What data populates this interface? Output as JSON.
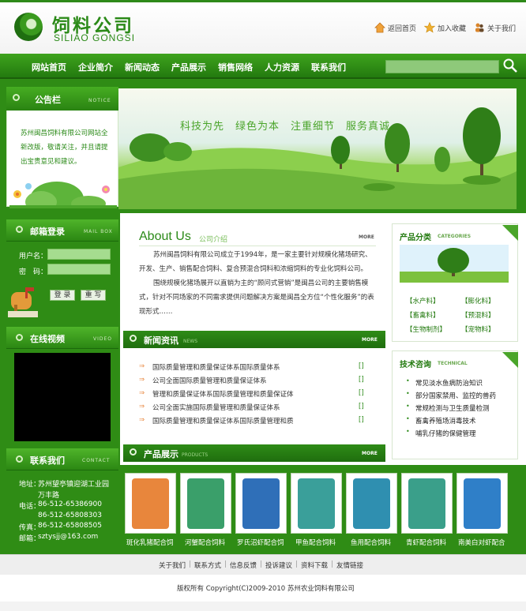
{
  "header": {
    "logo_cn": "饲料公司",
    "logo_en": "SILIAO GONGSI",
    "links": [
      {
        "label": "返回首页",
        "icon": "home-icon"
      },
      {
        "label": "加入收藏",
        "icon": "star-icon"
      },
      {
        "label": "关于我们",
        "icon": "people-icon"
      }
    ]
  },
  "nav": {
    "items": [
      "网站首页",
      "企业简介",
      "新闻动态",
      "产品展示",
      "销售网络",
      "人力资源",
      "联系我们"
    ]
  },
  "notice": {
    "title": "公告栏",
    "title_en": "NOTICE",
    "text": "苏州闽昌饲料有限公司网站全新改版，敬请关注，并且请提出宝贵意见和建议。"
  },
  "banner": {
    "slogan": "科技为先　绿色为本　注重细节　服务真诚"
  },
  "mail_login": {
    "title": "邮箱登录",
    "title_en": "MAIL BOX",
    "username_label": "用户名：",
    "password_label": "密　码：",
    "login_button": "登 录",
    "reset_button": "重 写"
  },
  "video": {
    "title": "在线视频",
    "title_en": "VIDEO"
  },
  "contact": {
    "title": "联系我们",
    "title_en": "CONTACT",
    "address_label": "地址：",
    "address_line1": "苏州望亭镇迎湖工业园",
    "address_line2": "万丰路",
    "phone_label": "电话：",
    "phone1": "86-512-65386900",
    "phone2": "86-512-65808303",
    "fax_label": "传真：",
    "fax": "86-512-65808505",
    "email_label": "邮箱：",
    "email": "sztysjj@163.com"
  },
  "about": {
    "title": "About Us",
    "subtitle": "公司介绍",
    "more": "MORE",
    "para1": "苏州闽昌饲料有限公司成立于1994年，是一家主要针对规模化猪场研究、开发、生产、销售配合饲料、复合预混合饲料和浓缩饲料的专业化饲料公司。",
    "para2": "围绕规模化猪场展开以直销为主的“顾问式营销”是闽昌公司的主要销售模式，针对不同场家的不同需求提供问题解决方案是闽昌全方位“个性化服务”的表现形式……"
  },
  "news": {
    "title": "新闻资讯",
    "title_en": "NEWS",
    "more": "MORE",
    "items": [
      {
        "text": "国际质量管理和质量保证体系国际质量体系",
        "date": "[]"
      },
      {
        "text": "公司全面国际质量管理和质量保证体系",
        "date": "[]"
      },
      {
        "text": "管理和质量保证体系国际质量管理和质量保证体",
        "date": "[]"
      },
      {
        "text": "公司全面实施国际质量管理和质量保证体系",
        "date": "[]"
      },
      {
        "text": "国际质量管理和质量保证体系国际质量管理和质",
        "date": "[]"
      }
    ]
  },
  "categories": {
    "title": "产品分类",
    "title_en": "CATEGORIES",
    "items": [
      "【水产料】",
      "【膨化料】",
      "【畜禽料】",
      "【预混料】",
      "【生物制剂】",
      "【宠物料】"
    ]
  },
  "tech": {
    "title": "技术咨询",
    "title_en": "TECHNICAL",
    "items": [
      "常见淡水鱼病防治知识",
      "部分国家禁用、监控的兽药",
      "常规检测与卫生质量检测",
      "畜禽养殖场消毒技术",
      "哺乳仔猪的保健管理"
    ]
  },
  "products": {
    "title": "产品展示",
    "title_en": "PRODUCTS",
    "more": "MORE",
    "items": [
      {
        "name": "斑化乳猪配合饲",
        "color": "#e8863c"
      },
      {
        "name": "河蟹配合饲料",
        "color": "#3a9f6a"
      },
      {
        "name": "罗氏沼虾配合饲",
        "color": "#2f6fb8"
      },
      {
        "name": "甲鱼配合饲料",
        "color": "#3a9f9a"
      },
      {
        "name": "鱼用配合饲料",
        "color": "#2f8fb0"
      },
      {
        "name": "青虾配合饲料",
        "color": "#3a9f8a"
      },
      {
        "name": "南美白对虾配合",
        "color": "#2f7fc8"
      }
    ]
  },
  "footer": {
    "links": [
      "关于我们",
      "联系方式",
      "信息反馈",
      "投诉建议",
      "资料下载",
      "友情链接"
    ],
    "copyright": "版权所有  Copyright(C)2009-2010 苏州农业饲料有限公司"
  },
  "colors": {
    "brand_green": "#2b8a18",
    "nav_green": "#2f8c15",
    "accent_orange": "#e8863c"
  }
}
